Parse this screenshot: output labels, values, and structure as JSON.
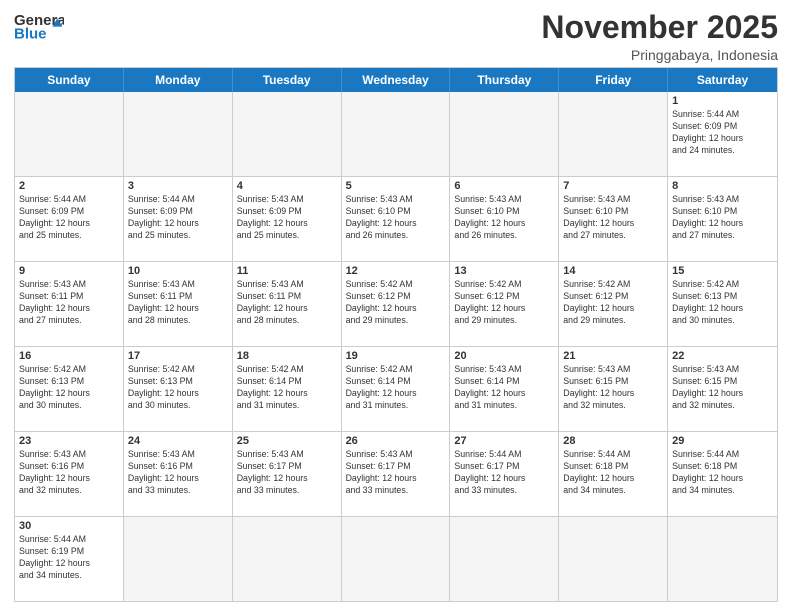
{
  "header": {
    "logo_general": "General",
    "logo_blue": "Blue",
    "month_title": "November 2025",
    "location": "Pringgabaya, Indonesia"
  },
  "days_of_week": [
    "Sunday",
    "Monday",
    "Tuesday",
    "Wednesday",
    "Thursday",
    "Friday",
    "Saturday"
  ],
  "weeks": [
    [
      {
        "day": "",
        "info": ""
      },
      {
        "day": "",
        "info": ""
      },
      {
        "day": "",
        "info": ""
      },
      {
        "day": "",
        "info": ""
      },
      {
        "day": "",
        "info": ""
      },
      {
        "day": "",
        "info": ""
      },
      {
        "day": "1",
        "info": "Sunrise: 5:44 AM\nSunset: 6:09 PM\nDaylight: 12 hours\nand 24 minutes."
      }
    ],
    [
      {
        "day": "2",
        "info": "Sunrise: 5:44 AM\nSunset: 6:09 PM\nDaylight: 12 hours\nand 25 minutes."
      },
      {
        "day": "3",
        "info": "Sunrise: 5:44 AM\nSunset: 6:09 PM\nDaylight: 12 hours\nand 25 minutes."
      },
      {
        "day": "4",
        "info": "Sunrise: 5:43 AM\nSunset: 6:09 PM\nDaylight: 12 hours\nand 25 minutes."
      },
      {
        "day": "5",
        "info": "Sunrise: 5:43 AM\nSunset: 6:10 PM\nDaylight: 12 hours\nand 26 minutes."
      },
      {
        "day": "6",
        "info": "Sunrise: 5:43 AM\nSunset: 6:10 PM\nDaylight: 12 hours\nand 26 minutes."
      },
      {
        "day": "7",
        "info": "Sunrise: 5:43 AM\nSunset: 6:10 PM\nDaylight: 12 hours\nand 27 minutes."
      },
      {
        "day": "8",
        "info": "Sunrise: 5:43 AM\nSunset: 6:10 PM\nDaylight: 12 hours\nand 27 minutes."
      }
    ],
    [
      {
        "day": "9",
        "info": "Sunrise: 5:43 AM\nSunset: 6:11 PM\nDaylight: 12 hours\nand 27 minutes."
      },
      {
        "day": "10",
        "info": "Sunrise: 5:43 AM\nSunset: 6:11 PM\nDaylight: 12 hours\nand 28 minutes."
      },
      {
        "day": "11",
        "info": "Sunrise: 5:43 AM\nSunset: 6:11 PM\nDaylight: 12 hours\nand 28 minutes."
      },
      {
        "day": "12",
        "info": "Sunrise: 5:42 AM\nSunset: 6:12 PM\nDaylight: 12 hours\nand 29 minutes."
      },
      {
        "day": "13",
        "info": "Sunrise: 5:42 AM\nSunset: 6:12 PM\nDaylight: 12 hours\nand 29 minutes."
      },
      {
        "day": "14",
        "info": "Sunrise: 5:42 AM\nSunset: 6:12 PM\nDaylight: 12 hours\nand 29 minutes."
      },
      {
        "day": "15",
        "info": "Sunrise: 5:42 AM\nSunset: 6:13 PM\nDaylight: 12 hours\nand 30 minutes."
      }
    ],
    [
      {
        "day": "16",
        "info": "Sunrise: 5:42 AM\nSunset: 6:13 PM\nDaylight: 12 hours\nand 30 minutes."
      },
      {
        "day": "17",
        "info": "Sunrise: 5:42 AM\nSunset: 6:13 PM\nDaylight: 12 hours\nand 30 minutes."
      },
      {
        "day": "18",
        "info": "Sunrise: 5:42 AM\nSunset: 6:14 PM\nDaylight: 12 hours\nand 31 minutes."
      },
      {
        "day": "19",
        "info": "Sunrise: 5:42 AM\nSunset: 6:14 PM\nDaylight: 12 hours\nand 31 minutes."
      },
      {
        "day": "20",
        "info": "Sunrise: 5:43 AM\nSunset: 6:14 PM\nDaylight: 12 hours\nand 31 minutes."
      },
      {
        "day": "21",
        "info": "Sunrise: 5:43 AM\nSunset: 6:15 PM\nDaylight: 12 hours\nand 32 minutes."
      },
      {
        "day": "22",
        "info": "Sunrise: 5:43 AM\nSunset: 6:15 PM\nDaylight: 12 hours\nand 32 minutes."
      }
    ],
    [
      {
        "day": "23",
        "info": "Sunrise: 5:43 AM\nSunset: 6:16 PM\nDaylight: 12 hours\nand 32 minutes."
      },
      {
        "day": "24",
        "info": "Sunrise: 5:43 AM\nSunset: 6:16 PM\nDaylight: 12 hours\nand 33 minutes."
      },
      {
        "day": "25",
        "info": "Sunrise: 5:43 AM\nSunset: 6:17 PM\nDaylight: 12 hours\nand 33 minutes."
      },
      {
        "day": "26",
        "info": "Sunrise: 5:43 AM\nSunset: 6:17 PM\nDaylight: 12 hours\nand 33 minutes."
      },
      {
        "day": "27",
        "info": "Sunrise: 5:44 AM\nSunset: 6:17 PM\nDaylight: 12 hours\nand 33 minutes."
      },
      {
        "day": "28",
        "info": "Sunrise: 5:44 AM\nSunset: 6:18 PM\nDaylight: 12 hours\nand 34 minutes."
      },
      {
        "day": "29",
        "info": "Sunrise: 5:44 AM\nSunset: 6:18 PM\nDaylight: 12 hours\nand 34 minutes."
      }
    ],
    [
      {
        "day": "30",
        "info": "Sunrise: 5:44 AM\nSunset: 6:19 PM\nDaylight: 12 hours\nand 34 minutes."
      },
      {
        "day": "",
        "info": ""
      },
      {
        "day": "",
        "info": ""
      },
      {
        "day": "",
        "info": ""
      },
      {
        "day": "",
        "info": ""
      },
      {
        "day": "",
        "info": ""
      },
      {
        "day": "",
        "info": ""
      }
    ]
  ]
}
